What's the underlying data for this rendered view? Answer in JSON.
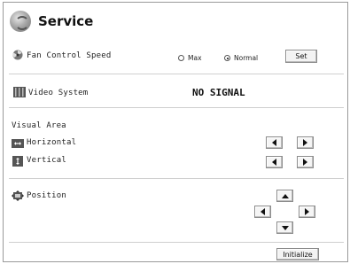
{
  "header": {
    "title": "Service",
    "icon": "service-logo-icon"
  },
  "fan": {
    "label": "Fan Control Speed",
    "options": [
      {
        "label": "Max",
        "selected": false
      },
      {
        "label": "Normal",
        "selected": true
      }
    ],
    "set_label": "Set"
  },
  "video": {
    "label": "Video System",
    "value": "NO SIGNAL"
  },
  "visual_area": {
    "heading": "Visual Area",
    "horizontal_label": "Horizontal",
    "vertical_label": "Vertical"
  },
  "position": {
    "label": "Position"
  },
  "footer": {
    "initialize_label": "Initialize"
  }
}
